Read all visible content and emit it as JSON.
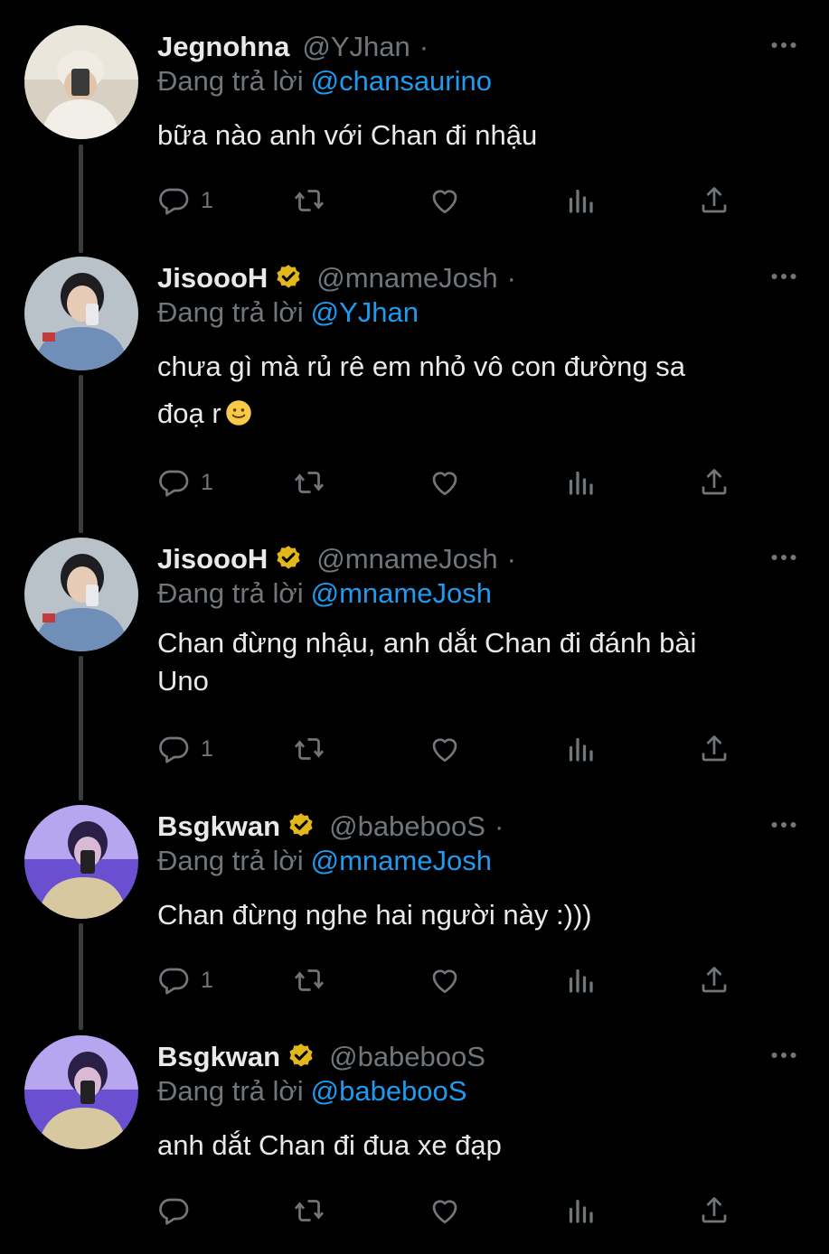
{
  "tweets": [
    {
      "name": "Jegnohna",
      "handle": "@YJhan",
      "verified": false,
      "replying_label": "Đang trả lời",
      "replying_to": "@chansaurino",
      "text": "bữa nào anh với Chan đi nhậu",
      "reply_count": "1"
    },
    {
      "name": "JisoooH",
      "handle": "@mnameJosh",
      "verified": true,
      "replying_label": "Đang trả lời",
      "replying_to": "@YJhan",
      "text_line1": "chưa gì mà rủ rê em nhỏ vô con đường sa",
      "text_line2": "đoạ r",
      "reply_count": "1"
    },
    {
      "name": "JisoooH",
      "handle": "@mnameJosh",
      "verified": true,
      "replying_label": "Đang trả lời",
      "replying_to": "@mnameJosh",
      "text_line1": "Chan đừng nhậu, anh dắt Chan đi đánh bài",
      "text_line2": "Uno",
      "reply_count": "1"
    },
    {
      "name": "Bsgkwan",
      "handle": "@babebooS",
      "verified": true,
      "replying_label": "Đang trả lời",
      "replying_to": "@mnameJosh",
      "text": "Chan đừng nghe hai người này :)))",
      "reply_count": "1"
    },
    {
      "name": "Bsgkwan",
      "handle": "@babebooS",
      "verified": true,
      "replying_label": "Đang trả lời",
      "replying_to": "@babebooS",
      "text": "anh dắt Chan đi đua xe đạp",
      "reply_count": ""
    }
  ],
  "separator": "·",
  "icons": [
    "more-icon",
    "reply-icon",
    "retweet-icon",
    "like-icon",
    "views-icon",
    "share-icon",
    "verified-badge-icon",
    "smile-emoji"
  ],
  "colors": {
    "background": "#000000",
    "text": "#e7e9ea",
    "muted": "#71767b",
    "link": "#1d9bf0",
    "verified": "#e2b719"
  }
}
